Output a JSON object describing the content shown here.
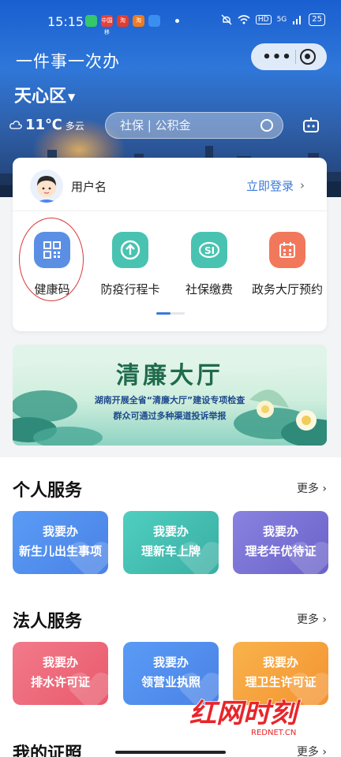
{
  "status_bar": {
    "time": "15:15",
    "apps": [
      {
        "name": "app-icon-green",
        "color": "#35c86b",
        "label": ""
      },
      {
        "name": "app-icon-red",
        "color": "#e8403a",
        "label": "中国移"
      },
      {
        "name": "app-icon-red2",
        "color": "#e23d2f",
        "label": "淘"
      },
      {
        "name": "app-icon-orange",
        "color": "#f07a20",
        "label": "淘"
      },
      {
        "name": "app-icon-blue",
        "color": "#3a8ef0",
        "label": ""
      }
    ],
    "network": "HD",
    "signal": "5G",
    "battery": "25"
  },
  "header": {
    "app_title": "一件事一次办",
    "district": "天心区",
    "district_caret": "▼",
    "temperature": "11℃",
    "weather": "多云",
    "search_placeholder": "社保 | 公积金"
  },
  "user": {
    "name": "用户名",
    "login_label": "立即登录",
    "login_arrow": "›"
  },
  "quick_actions": [
    {
      "label": "健康码",
      "icon": "qr-code-icon",
      "color": "#5b8fe3"
    },
    {
      "label": "防疫行程卡",
      "icon": "arrow-up-circle-icon",
      "color": "#49c3b1"
    },
    {
      "label": "社保缴费",
      "icon": "social-security-icon",
      "color": "#49c3b1"
    },
    {
      "label": "政务大厅预约",
      "icon": "calendar-icon",
      "color": "#f2785c"
    }
  ],
  "banner": {
    "title": "清廉大厅",
    "line1": "湖南开展全省“清廉大厅”建设专项检查",
    "line2": "群众可通过多种渠道投诉举报"
  },
  "personal_services": {
    "title": "个人服务",
    "more": "更多",
    "items": [
      {
        "line1": "我要办",
        "line2": "新生儿出生事项"
      },
      {
        "line1": "我要办",
        "line2": "理新车上牌"
      },
      {
        "line1": "我要办",
        "line2": "理老年优待证"
      }
    ]
  },
  "legal_services": {
    "title": "法人服务",
    "more": "更多",
    "items": [
      {
        "line1": "我要办",
        "line2": "排水许可证"
      },
      {
        "line1": "我要办",
        "line2": "领营业执照"
      },
      {
        "line1": "我要办",
        "line2": "理卫生许可证"
      }
    ]
  },
  "certificates": {
    "title": "我的证照",
    "more": "更多"
  },
  "watermark": {
    "main": "红网时刻",
    "sub": "REDNET.CN"
  },
  "colors": {
    "accent": "#3b7ad8",
    "card_blue": "#4f8ef0",
    "card_teal": "#3fc1b3",
    "card_purple": "#7a72d6",
    "card_red": "#ee6173",
    "card_orange": "#f6a23a"
  }
}
